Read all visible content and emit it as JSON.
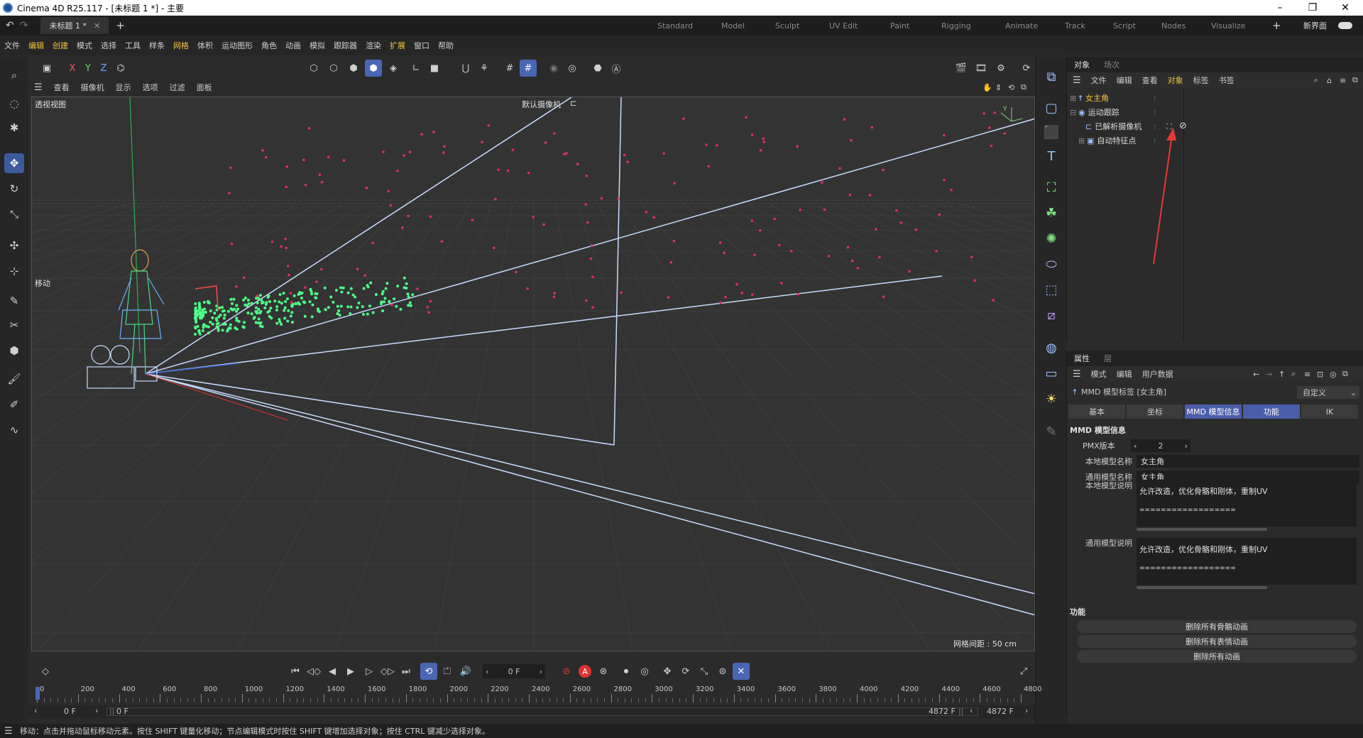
{
  "window": {
    "title": "Cinema 4D R25.117 - [未标题 1 *] - 主要"
  },
  "tabs": {
    "doc_tab": "未标题 1 *",
    "add": "+"
  },
  "layouts": [
    "Standard",
    "Model",
    "Sculpt",
    "UV Edit",
    "Paint",
    "Rigging",
    "Animate",
    "Track",
    "Script",
    "Nodes",
    "Visualize"
  ],
  "new_ui_label": "新界面",
  "menu": [
    "文件",
    "编辑",
    "创建",
    "模式",
    "选择",
    "工具",
    "样条",
    "网格",
    "体积",
    "运动图形",
    "角色",
    "动画",
    "模拟",
    "跟踪器",
    "渲染",
    "扩展",
    "窗口",
    "帮助"
  ],
  "toolbar": {
    "x": "X",
    "y": "Y",
    "z": "Z"
  },
  "viewport": {
    "menu": [
      "查看",
      "摄像机",
      "显示",
      "选项",
      "过滤",
      "面板"
    ],
    "view_name": "透视视图",
    "camera_name": "默认摄像机",
    "move_label": "移动",
    "grid_info": "网格间距 : 50 cm",
    "axis_y": "Y"
  },
  "objects_panel": {
    "tabs": [
      "对象",
      "场次"
    ],
    "menu": [
      "文件",
      "编辑",
      "查看",
      "对象",
      "标签",
      "书签"
    ],
    "items": [
      {
        "name": "女主角",
        "highlight": true
      },
      {
        "name": "运动跟踪"
      },
      {
        "name": "已解析摄像机"
      },
      {
        "name": "自动特征点"
      }
    ]
  },
  "attributes_panel": {
    "tabs": [
      "属性",
      "层"
    ],
    "menu": [
      "模式",
      "编辑",
      "用户数据"
    ],
    "header": "MMD 模型标签 [女主角]",
    "preset": "自定义",
    "subtabs": [
      "基本",
      "坐标",
      "MMD 模型信息",
      "功能",
      "IK"
    ],
    "section_title": "MMD 模型信息",
    "fields": {
      "pmx_label": "PMX版本",
      "pmx_value": "2",
      "local_name_label": "本地模型名称",
      "local_name_value": "女主角",
      "common_name_label": "通用模型名称",
      "common_name_value": "女主角",
      "local_desc_label": "本地模型说明",
      "local_desc_value": "允许改造，优化骨骼和刚体，重制UV",
      "common_desc_label": "通用模型说明",
      "common_desc_value": "允许改造，优化骨骼和刚体，重制UV",
      "desc_separator": "=================="
    },
    "func_title": "功能",
    "buttons": [
      "删除所有骨骼动画",
      "删除所有表情动画",
      "删除所有动画"
    ]
  },
  "timeline": {
    "frame_field": "0 F",
    "ticks": [
      "0",
      "200",
      "400",
      "600",
      "800",
      "1000",
      "1200",
      "1400",
      "1600",
      "1800",
      "2000",
      "2200",
      "2400",
      "2600",
      "2800",
      "3000",
      "3200",
      "3400",
      "3600",
      "3800",
      "4000",
      "4200",
      "4400",
      "4600",
      "4800"
    ],
    "start": "0 F",
    "start2": "0 F",
    "end": "4872 F",
    "end2": "4872 F"
  },
  "status": "移动：点击并拖动鼠标移动元素。按住 SHIFT 键量化移动；节点编辑模式时按住 SHIFT 键增加选择对象；按住 CTRL 键减少选择对象。",
  "colors": {
    "accent": "#4a67b5",
    "highlight_text": "#f0c43a",
    "arrow": "#e53935",
    "track_points_green": "#4dff88",
    "track_points_pink": "#e0306a"
  }
}
